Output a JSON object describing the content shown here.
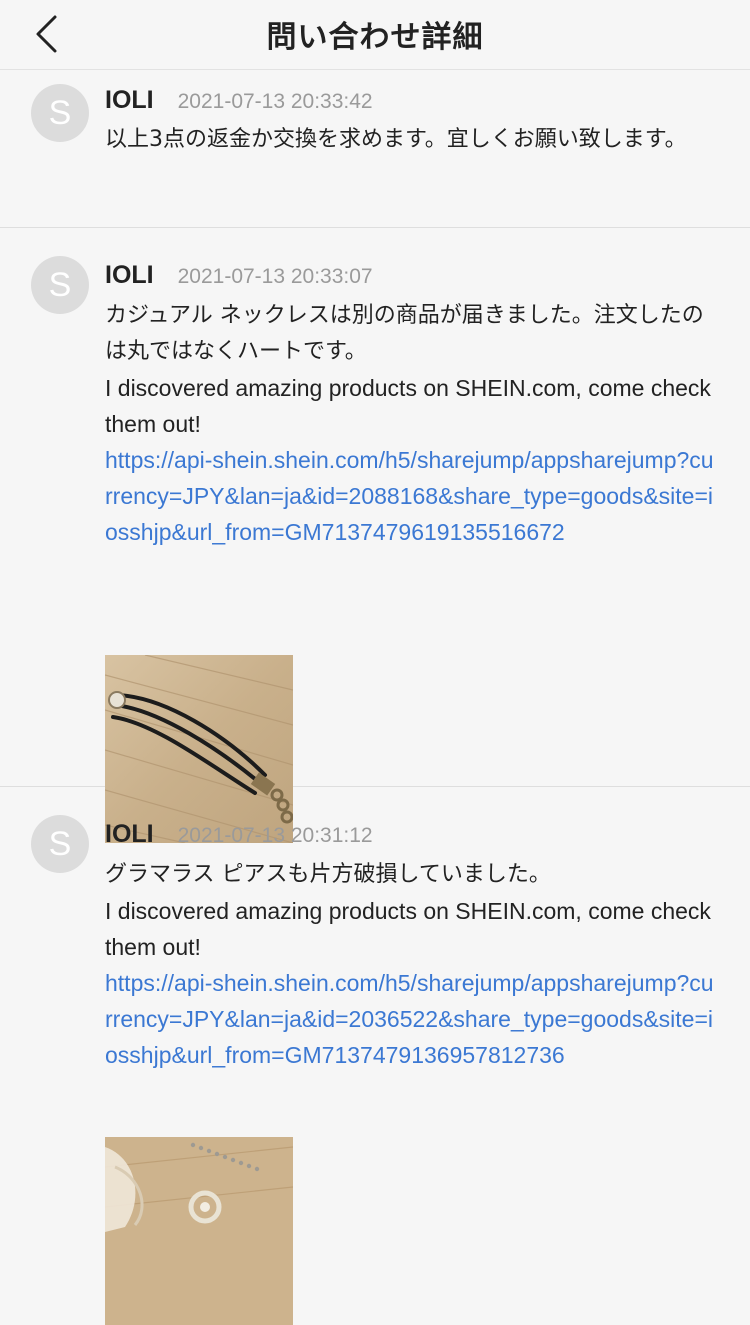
{
  "header": {
    "title": "問い合わせ詳細"
  },
  "messages": [
    {
      "avatar_letter": "S",
      "name": "IOLI",
      "time": "2021-07-13 20:33:42",
      "text": "以上3点の返金か交換を求めます。宜しくお願い致します。"
    },
    {
      "avatar_letter": "S",
      "name": "IOLI",
      "time": "2021-07-13 20:33:07",
      "text": "カジュアル ネックレスは別の商品が届きました。注文したのは丸ではなくハートです。",
      "share_text": "I discovered amazing products on SHEIN.com, come check them out!",
      "link": "https://api-shein.shein.com/h5/sharejump/appsharejump?currency=JPY&lan=ja&id=2088168&share_type=goods&site=iosshjp&url_from=GM7137479619135516672"
    },
    {
      "avatar_letter": "S",
      "name": "IOLI",
      "time": "2021-07-13 20:31:12",
      "text": "グラマラス ピアスも片方破損していました。",
      "share_text": "I discovered amazing products on SHEIN.com, come check them out!",
      "link": "https://api-shein.shein.com/h5/sharejump/appsharejump?currency=JPY&lan=ja&id=2036522&share_type=goods&site=iosshjp&url_from=GM7137479136957812736"
    }
  ]
}
